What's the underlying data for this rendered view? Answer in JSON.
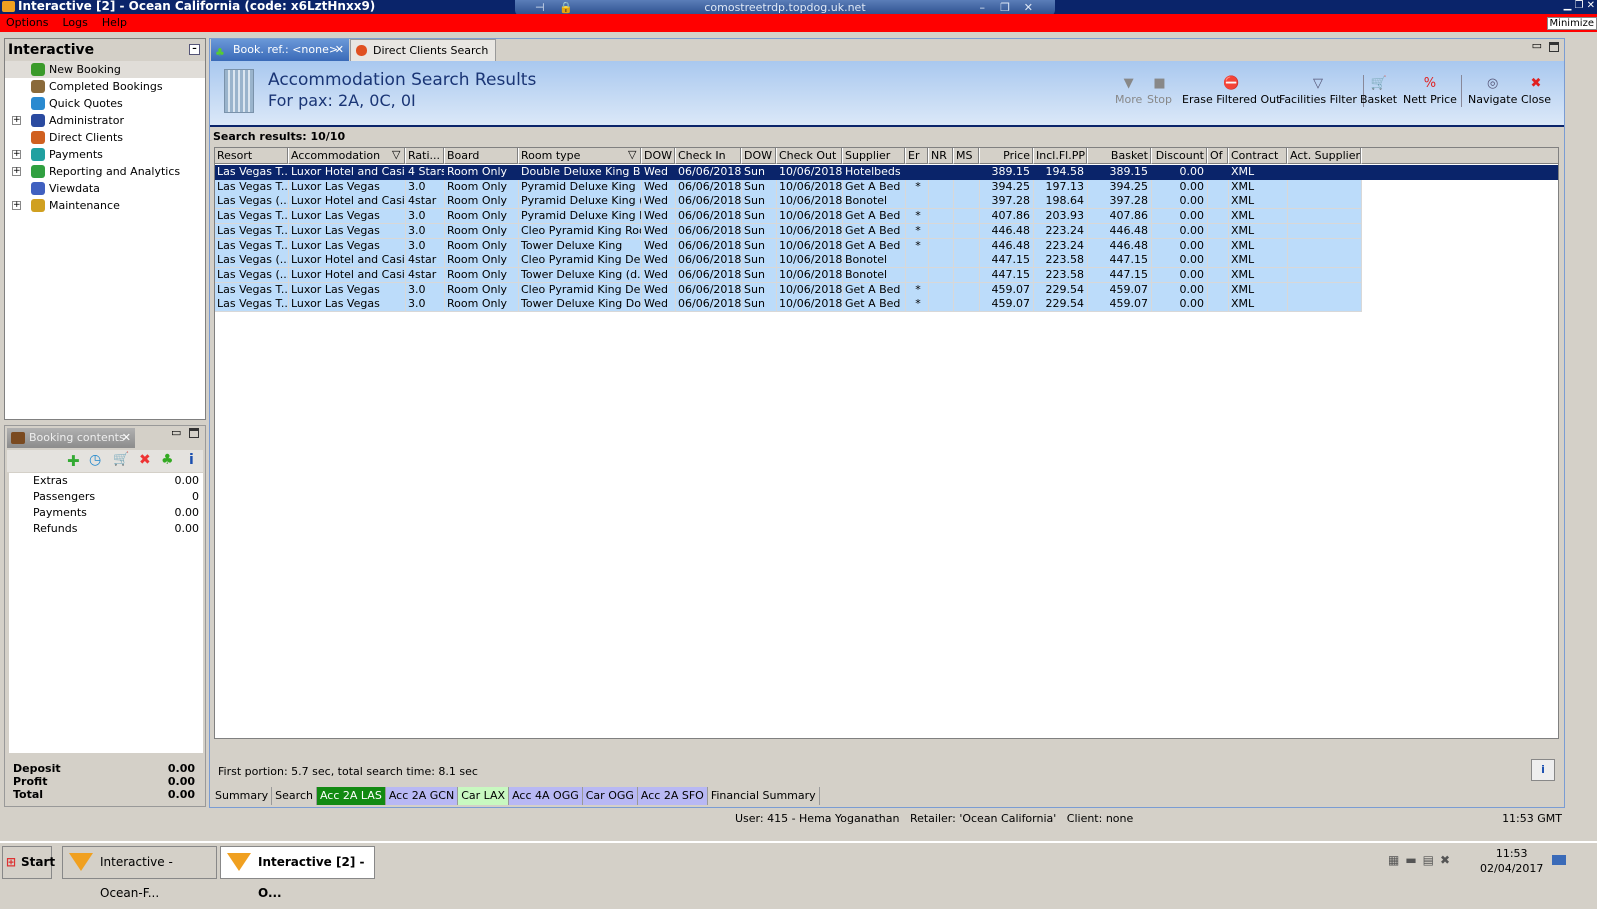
{
  "window": {
    "title": "Interactive [2] - Ocean California (code: x6LztHnxx9)",
    "rdp_host": "comostreetrdp.topdog.uk.net",
    "minimize_tooltip": "Minimize"
  },
  "menu": [
    "Options",
    "Logs",
    "Help"
  ],
  "nav": {
    "title": "Interactive",
    "items": [
      {
        "label": "New Booking",
        "expandable": false,
        "color": "#3a9a2a"
      },
      {
        "label": "Completed Bookings",
        "expandable": false,
        "color": "#8a6a3a"
      },
      {
        "label": "Quick Quotes",
        "expandable": false,
        "color": "#2a8ad0"
      },
      {
        "label": "Administrator",
        "expandable": true,
        "color": "#2a4aa0"
      },
      {
        "label": "Direct Clients",
        "expandable": false,
        "color": "#d06020"
      },
      {
        "label": "Payments",
        "expandable": true,
        "color": "#20a0a0"
      },
      {
        "label": "Reporting and Analytics",
        "expandable": true,
        "color": "#30a040"
      },
      {
        "label": "Viewdata",
        "expandable": false,
        "color": "#4060c0"
      },
      {
        "label": "Maintenance",
        "expandable": true,
        "color": "#d0a020"
      }
    ]
  },
  "booking_contents": {
    "tab_label": "Booking contents",
    "rows": [
      {
        "label": "Extras",
        "value": "0.00"
      },
      {
        "label": "Passengers",
        "value": "0"
      },
      {
        "label": "Payments",
        "value": "0.00"
      },
      {
        "label": "Refunds",
        "value": "0.00"
      }
    ],
    "totals": [
      {
        "label": "Deposit",
        "value": "0.00"
      },
      {
        "label": "Profit",
        "value": "0.00"
      },
      {
        "label": "Total",
        "value": "0.00"
      }
    ]
  },
  "tabs": [
    {
      "label": "Book. ref.: <none>",
      "active": true
    },
    {
      "label": "Direct Clients Search",
      "active": false
    }
  ],
  "header": {
    "title": "Accommodation Search Results",
    "subtitle": "For pax: 2A, 0C, 0I"
  },
  "toolbar": [
    {
      "label": "More",
      "icon": "triangle-down-icon",
      "glyph": "▼",
      "enabled": false
    },
    {
      "label": "Stop",
      "icon": "stop-icon",
      "glyph": "■",
      "enabled": false
    },
    {
      "label": "Erase Filtered Out",
      "icon": "erase-icon",
      "glyph": "⛔",
      "enabled": true
    },
    {
      "label": "Facilities Filter",
      "icon": "funnel-icon",
      "glyph": "▽",
      "enabled": true
    },
    {
      "label": "Basket",
      "icon": "basket-icon",
      "glyph": "🛒",
      "enabled": true
    },
    {
      "label": "Nett Price",
      "icon": "nett-price-icon",
      "glyph": "%",
      "enabled": true
    },
    {
      "label": "Navigate",
      "icon": "compass-icon",
      "glyph": "◎",
      "enabled": true
    },
    {
      "label": "Close",
      "icon": "close-icon",
      "glyph": "✖",
      "enabled": true
    }
  ],
  "results_count": "Search results: 10/10",
  "columns": [
    "Resort",
    "Accommodation",
    "Rati...",
    "Board",
    "Room type",
    "DOW",
    "Check In",
    "DOW",
    "Check Out",
    "Supplier",
    "Er",
    "NR",
    "MS",
    "Price",
    "Incl.Fl.PP",
    "Basket",
    "Discount",
    "Of",
    "Contract",
    "Act. Supplier"
  ],
  "rows": [
    [
      "Las Vegas T...",
      "Luxor Hotel and Casino",
      "4 Stars",
      "Room Only",
      "Double Deluxe King Bed",
      "Wed",
      "06/06/2018",
      "Sun",
      "10/06/2018",
      "Hotelbeds",
      "",
      "",
      "",
      "389.15",
      "194.58",
      "389.15",
      "0.00",
      "",
      "XML",
      ""
    ],
    [
      "Las Vegas T...",
      "Luxor Las Vegas",
      "3.0",
      "Room Only",
      "Pyramid Deluxe King",
      "Wed",
      "06/06/2018",
      "Sun",
      "10/06/2018",
      "Get A Bed",
      "*",
      "",
      "",
      "394.25",
      "197.13",
      "394.25",
      "0.00",
      "",
      "XML",
      ""
    ],
    [
      "Las Vegas (...",
      "Luxor Hotel and Casino",
      "4star",
      "Room Only",
      "Pyramid Deluxe King (...",
      "Wed",
      "06/06/2018",
      "Sun",
      "10/06/2018",
      "Bonotel",
      "",
      "",
      "",
      "397.28",
      "198.64",
      "397.28",
      "0.00",
      "",
      "XML",
      ""
    ],
    [
      "Las Vegas T...",
      "Luxor Las Vegas",
      "3.0",
      "Room Only",
      "Pyramid Deluxe King D...",
      "Wed",
      "06/06/2018",
      "Sun",
      "10/06/2018",
      "Get A Bed",
      "*",
      "",
      "",
      "407.86",
      "203.93",
      "407.86",
      "0.00",
      "",
      "XML",
      ""
    ],
    [
      "Las Vegas T...",
      "Luxor Las Vegas",
      "3.0",
      "Room Only",
      "Cleo Pyramid King Room",
      "Wed",
      "06/06/2018",
      "Sun",
      "10/06/2018",
      "Get A Bed",
      "*",
      "",
      "",
      "446.48",
      "223.24",
      "446.48",
      "0.00",
      "",
      "XML",
      ""
    ],
    [
      "Las Vegas T...",
      "Luxor Las Vegas",
      "3.0",
      "Room Only",
      "Tower Deluxe King",
      "Wed",
      "06/06/2018",
      "Sun",
      "10/06/2018",
      "Get A Bed",
      "*",
      "",
      "",
      "446.48",
      "223.24",
      "446.48",
      "0.00",
      "",
      "XML",
      ""
    ],
    [
      "Las Vegas (...",
      "Luxor Hotel and Casino",
      "4star",
      "Room Only",
      "Cleo Pyramid King Del...",
      "Wed",
      "06/06/2018",
      "Sun",
      "10/06/2018",
      "Bonotel",
      "",
      "",
      "",
      "447.15",
      "223.58",
      "447.15",
      "0.00",
      "",
      "XML",
      ""
    ],
    [
      "Las Vegas (...",
      "Luxor Hotel and Casino",
      "4star",
      "Room Only",
      "Tower Deluxe King (d...",
      "Wed",
      "06/06/2018",
      "Sun",
      "10/06/2018",
      "Bonotel",
      "",
      "",
      "",
      "447.15",
      "223.58",
      "447.15",
      "0.00",
      "",
      "XML",
      ""
    ],
    [
      "Las Vegas T...",
      "Luxor Las Vegas",
      "3.0",
      "Room Only",
      "Cleo Pyramid King Del...",
      "Wed",
      "06/06/2018",
      "Sun",
      "10/06/2018",
      "Get A Bed",
      "*",
      "",
      "",
      "459.07",
      "229.54",
      "459.07",
      "0.00",
      "",
      "XML",
      ""
    ],
    [
      "Las Vegas T...",
      "Luxor Las Vegas",
      "3.0",
      "Room Only",
      "Tower Deluxe King Do...",
      "Wed",
      "06/06/2018",
      "Sun",
      "10/06/2018",
      "Get A Bed",
      "*",
      "",
      "",
      "459.07",
      "229.54",
      "459.07",
      "0.00",
      "",
      "XML",
      ""
    ]
  ],
  "selected_row": 0,
  "status": "First portion: 5.7 sec, total search time: 8.1 sec",
  "bottom_tabs": [
    {
      "label": "Summary",
      "bg": "#d4d0c8",
      "fg": "#000"
    },
    {
      "label": "Search",
      "bg": "#d4d0c8",
      "fg": "#000"
    },
    {
      "label": "Acc 2A LAS",
      "bg": "#128a12",
      "fg": "#fff"
    },
    {
      "label": "Acc 2A GCN",
      "bg": "#b8b8f4",
      "fg": "#000"
    },
    {
      "label": "Car LAX",
      "bg": "#c8f8c0",
      "fg": "#000"
    },
    {
      "label": "Acc 4A OGG",
      "bg": "#b8b8f4",
      "fg": "#000"
    },
    {
      "label": "Car OGG",
      "bg": "#b8b8f4",
      "fg": "#000"
    },
    {
      "label": "Acc 2A SFO",
      "bg": "#b8b8f4",
      "fg": "#000"
    },
    {
      "label": "Financial Summary",
      "bg": "#d4d0c8",
      "fg": "#000"
    }
  ],
  "user_line": "User: 415 - Hema Yoganathan   Retailer: 'Ocean California'   Client: none",
  "gmt_time": "11:53 GMT",
  "taskbar": {
    "start": "Start",
    "tasks": [
      "Interactive - Ocean-F...",
      "Interactive [2] - O..."
    ],
    "time": "11:53",
    "date": "02/04/2017"
  },
  "colors": {
    "selected_row": "#0a246a",
    "row_bg": "#bcdcfa",
    "menubar": "#ff0000"
  }
}
